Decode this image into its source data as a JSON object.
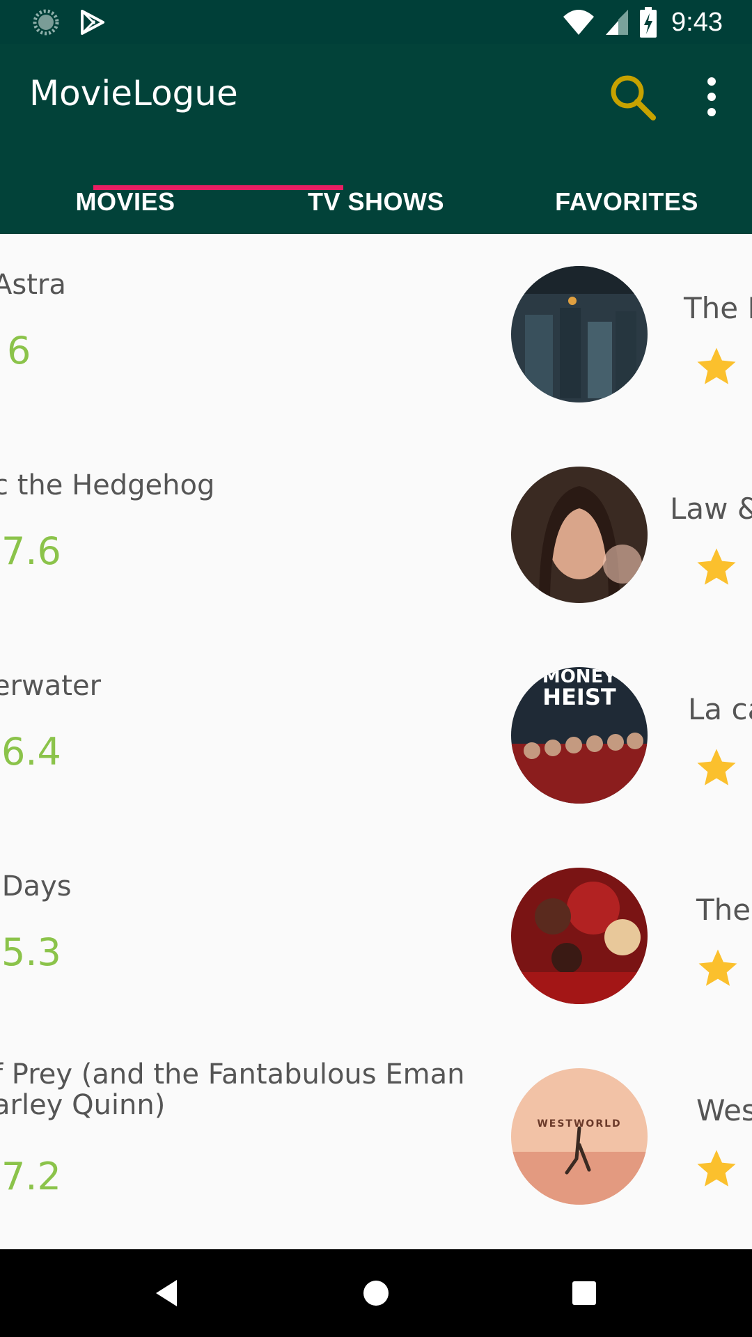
{
  "status_bar": {
    "time": "9:43",
    "icons": [
      "loading-icon",
      "play-store-icon",
      "wifi-icon",
      "signal-icon",
      "battery-charging-icon"
    ]
  },
  "app_bar": {
    "title": "MovieLogue",
    "search_icon": "search-icon",
    "more_icon": "more-vert-icon",
    "accent": "#c7a200"
  },
  "tabs": [
    {
      "label": "MOVIES",
      "selected": true
    },
    {
      "label": "TV SHOWS",
      "selected": false
    },
    {
      "label": "FAVORITES",
      "selected": false
    }
  ],
  "colors": {
    "primary": "#024239",
    "status_bar": "#003f38",
    "tab_indicator": "#e91e63",
    "rating_green": "#8bc34a",
    "star_yellow": "#fbc02d"
  },
  "movies": [
    {
      "title": "Astra",
      "rating": "6"
    },
    {
      "title": "c the Hedgehog",
      "rating": "7.6"
    },
    {
      "title": "erwater",
      "rating": "6.4"
    },
    {
      "title": " Days",
      "rating": "5.3"
    },
    {
      "title": "f Prey (and the Fantabulous Eman\narley Quinn)",
      "rating": "7.2"
    }
  ],
  "tv_shows": [
    {
      "title": "The F",
      "poster": "dark-show-poster"
    },
    {
      "title": "Law &",
      "poster": "woman-portrait-poster"
    },
    {
      "title": "La ca",
      "poster": "money-heist-poster",
      "poster_text": "MONEY\nHEIST"
    },
    {
      "title": "The",
      "poster": "flash-poster"
    },
    {
      "title": "West",
      "poster": "westworld-poster",
      "poster_text": "WESTWORLD"
    }
  ]
}
